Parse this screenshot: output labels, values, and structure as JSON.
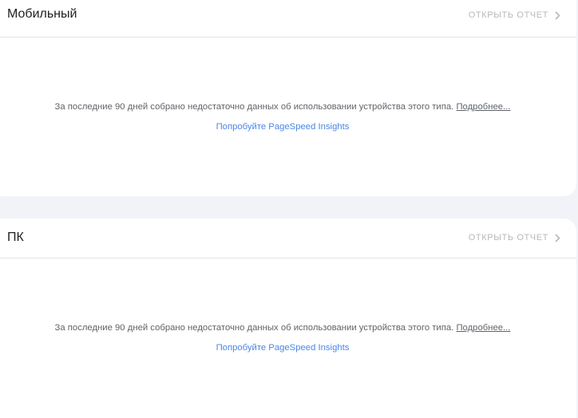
{
  "sections": [
    {
      "title": "Мобильный",
      "open_report_label": "ОТКРЫТЬ ОТЧЕТ",
      "message": "За последние 90 дней собрано недостаточно данных об использовании устройства этого типа.",
      "more_link": "Подробнее...",
      "psi_link": "Попробуйте PageSpeed Insights"
    },
    {
      "title": "ПК",
      "open_report_label": "ОТКРЫТЬ ОТЧЕТ",
      "message": "За последние 90 дней собрано недостаточно данных об использовании устройства этого типа.",
      "more_link": "Подробнее...",
      "psi_link": "Попробуйте PageSpeed Insights"
    }
  ],
  "colors": {
    "background": "#f1f3f8",
    "card": "#ffffff",
    "link": "#4a86e8",
    "muted": "#b5b8bd",
    "text": "#5f6368"
  },
  "icons": {
    "open_report": "chevron-right-icon"
  }
}
